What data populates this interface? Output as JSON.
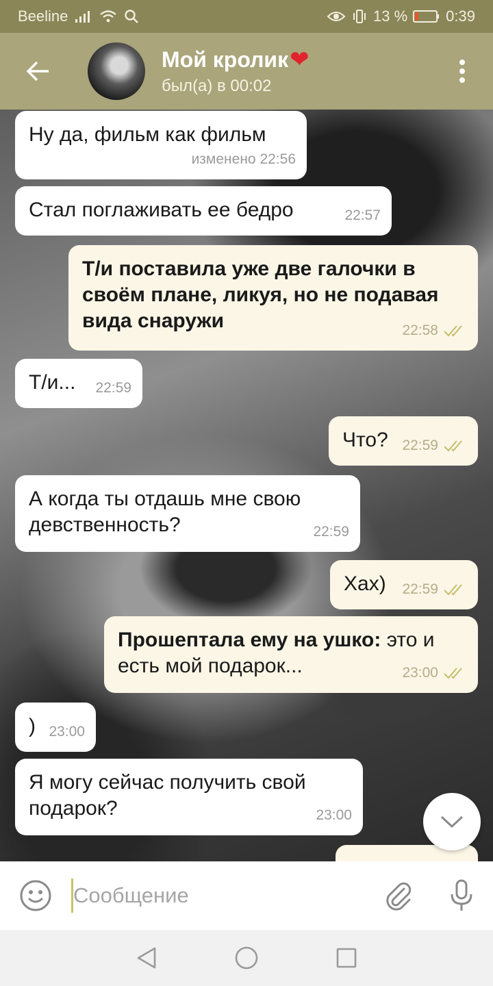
{
  "status_bar": {
    "carrier": "Beeline",
    "battery_percent": "13 %",
    "time": "0:39"
  },
  "header": {
    "title": "Мой кролик",
    "title_emoji": "❤",
    "status": "был(а) в 00:02"
  },
  "messages": [
    {
      "direction": "in",
      "text": "Ну да, фильм как фильм",
      "time": "изменено 22:56"
    },
    {
      "direction": "in",
      "text": "Стал поглаживать ее бедро",
      "time": "22:57"
    },
    {
      "direction": "out",
      "text": "Т/и поставила уже две галочки в своём плане, ликуя, но не подавая вида снаружи",
      "time": "22:58",
      "read": true
    },
    {
      "direction": "in",
      "text": "Т/и...",
      "time": "22:59"
    },
    {
      "direction": "out",
      "text": "Что?",
      "time": "22:59",
      "read": true
    },
    {
      "direction": "in",
      "text": "А когда ты отдашь мне свою девственность?",
      "time": "22:59"
    },
    {
      "direction": "out",
      "text": "Хах)",
      "time": "22:59",
      "read": true
    },
    {
      "direction": "out",
      "bold_prefix": "Прошептала ему на ушко:",
      "text": " это и есть мой подарок...",
      "time": "23:00",
      "read": true
    },
    {
      "direction": "in",
      "text": ")",
      "time": "23:00"
    },
    {
      "direction": "in",
      "text": "Я могу сейчас получить свой подарок?",
      "time": "23:00"
    }
  ],
  "input": {
    "placeholder": "Сообщение",
    "value": ""
  },
  "icons": {
    "back": "arrow-left-icon",
    "menu": "more-vertical-icon",
    "emoji": "smiley-icon",
    "attach": "paperclip-icon",
    "mic": "microphone-icon",
    "scroll_down": "chevron-down-icon",
    "nav_back": "triangle-back-icon",
    "nav_home": "circle-home-icon",
    "nav_recents": "square-recents-icon"
  },
  "colors": {
    "header": "#aaa57a",
    "status_bar": "#8b8658",
    "outgoing_bubble": "#fbf6e6",
    "incoming_bubble": "#ffffff",
    "read_check": "#c4bd6a"
  }
}
